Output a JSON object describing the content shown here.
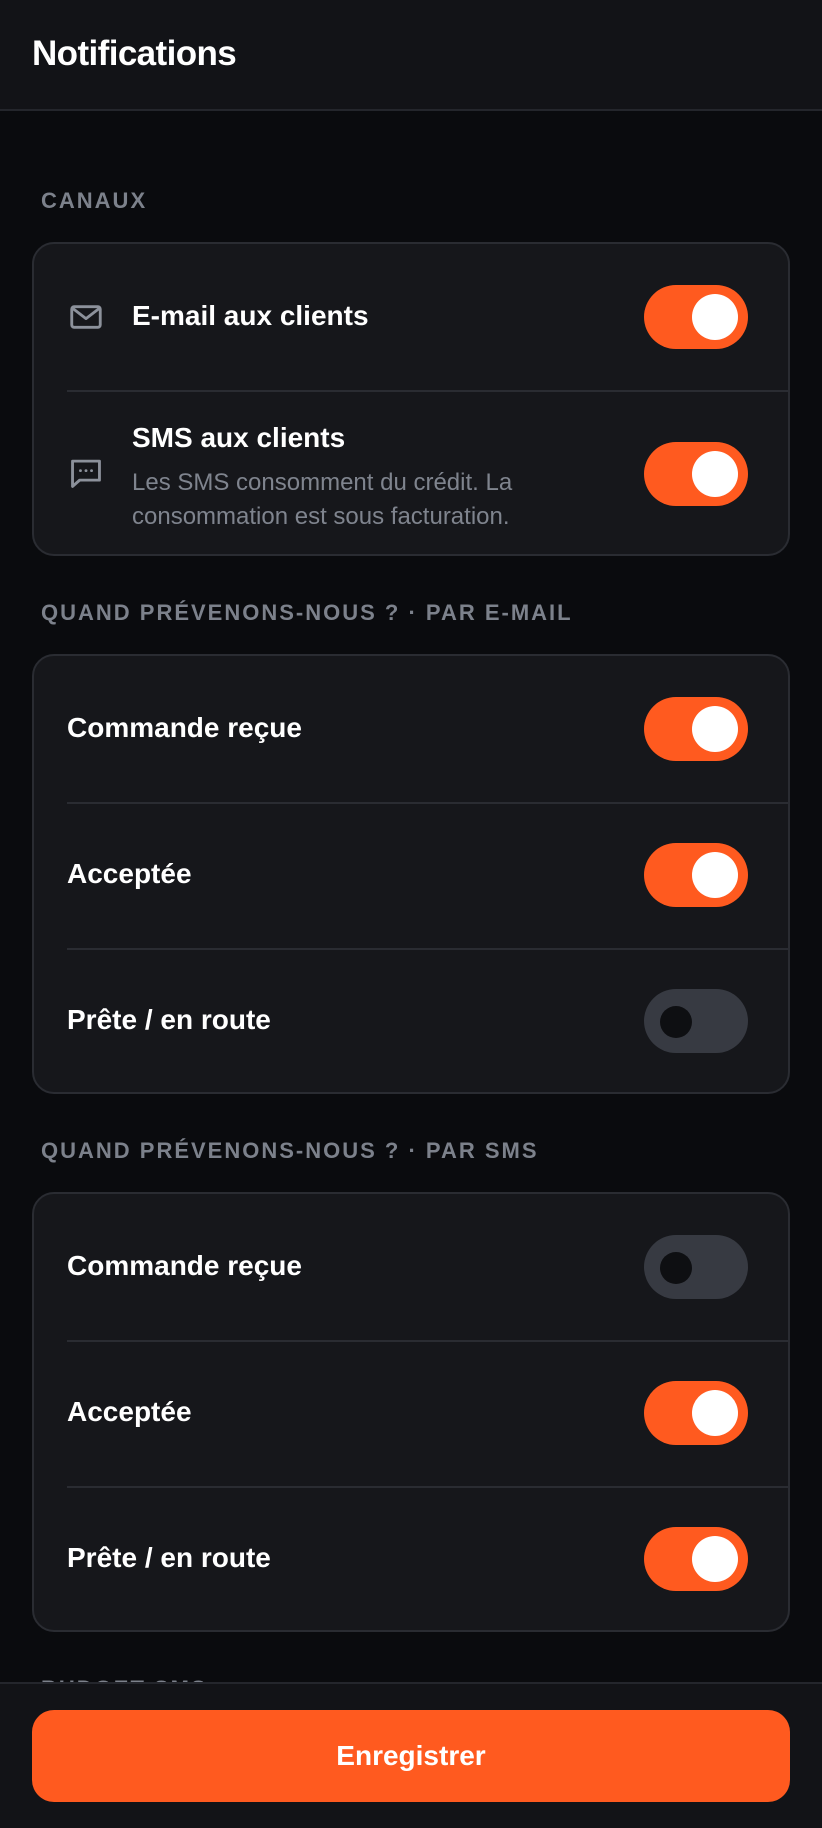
{
  "header": {
    "title": "Notifications"
  },
  "sections": {
    "channels": {
      "label": "CANAUX",
      "email": {
        "label": "E-mail aux clients",
        "enabled": true
      },
      "sms": {
        "label": "SMS aux clients",
        "description": "Les SMS consomment du crédit. La consommation est sous facturation.",
        "enabled": true
      }
    },
    "email_events": {
      "label": "QUAND PRÉVENONS-NOUS ? · PAR E-MAIL",
      "items": [
        {
          "label": "Commande reçue",
          "enabled": true
        },
        {
          "label": "Acceptée",
          "enabled": true
        },
        {
          "label": "Prête / en route",
          "enabled": false
        }
      ]
    },
    "sms_events": {
      "label": "QUAND PRÉVENONS-NOUS ? · PAR SMS",
      "items": [
        {
          "label": "Commande reçue",
          "enabled": false
        },
        {
          "label": "Acceptée",
          "enabled": true
        },
        {
          "label": "Prête / en route",
          "enabled": true
        }
      ]
    },
    "sms_budget": {
      "label": "BUDGET SMS"
    }
  },
  "footer": {
    "save_label": "Enregistrer"
  },
  "colors": {
    "accent": "#ff5a1f",
    "background": "#0a0b0e",
    "card": "#16171b",
    "toggle_off": "#373a42"
  },
  "icons": {
    "email": "envelope-icon",
    "sms": "chat-bubble-icon"
  }
}
